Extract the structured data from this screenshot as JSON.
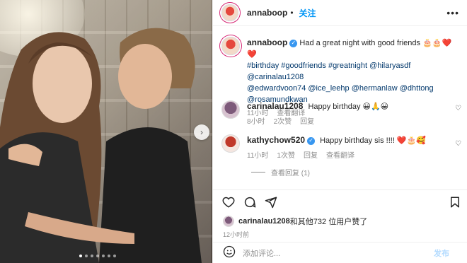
{
  "post": {
    "username": "annaboop",
    "follow_label": "关注",
    "more_label": "•••"
  },
  "caption": {
    "username": "annaboop",
    "text": "Had a great night with good friends 🎂🎂❤️❤️",
    "tags_line1": "#birthday #goodfriends #greatnight @hilaryasdf @carinalau1208",
    "tags_line2": "@edwardvoon74 @ice_leehp @hermanlaw @dhttong",
    "tags_line3": "@rosamundkwan",
    "time": "11小时",
    "see_translation": "查看翻译"
  },
  "comments": [
    {
      "username": "carinalau1208",
      "text": "Happy birthday 😀🙏😀",
      "time": "8小时",
      "likes": "2次赞",
      "reply": "回复"
    },
    {
      "username": "kathychow520",
      "text": "Happy birthday sis !!!! ❤️🎂🥰",
      "time": "11小时",
      "likes": "1次赞",
      "reply": "回复",
      "see_translation": "查看翻译",
      "view_replies": "查看回复 (1)"
    }
  ],
  "likes_line": {
    "user": "carinalau1208",
    "text": "和其他732 位用户赞了"
  },
  "post_time": "12小时前",
  "add_comment": {
    "placeholder": "添加评论...",
    "post_label": "发布"
  },
  "carousel": {
    "total": 7,
    "active": 0
  },
  "colors": {
    "link": "#0095f6",
    "tag": "#00376b",
    "muted": "#8e8e8e",
    "verified": "#3897f0"
  }
}
